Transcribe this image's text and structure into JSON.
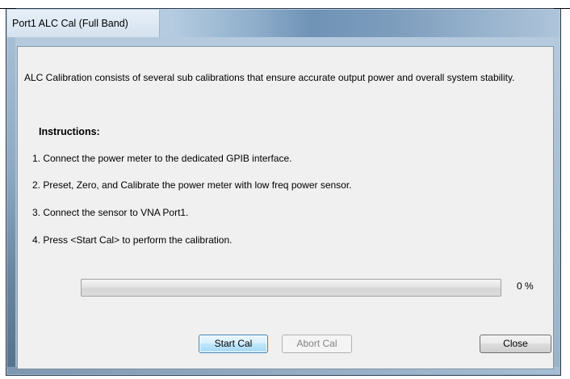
{
  "window": {
    "title": "Port1 ALC Cal (Full Band)"
  },
  "description": "ALC Calibration consists of several sub calibrations that ensure accurate output power and overall system stability.",
  "instructions": {
    "heading": "Instructions:",
    "steps": [
      "1.  Connect the power meter to the dedicated GPIB interface.",
      "2.  Preset, Zero, and Calibrate the power meter with low freq power sensor.",
      "3.  Connect the sensor to VNA Port1.",
      "4.  Press <Start Cal> to perform the calibration."
    ]
  },
  "progress": {
    "value_percent": 0,
    "label": "0 %"
  },
  "buttons": {
    "start": "Start Cal",
    "abort": "Abort Cal",
    "close": "Close"
  }
}
